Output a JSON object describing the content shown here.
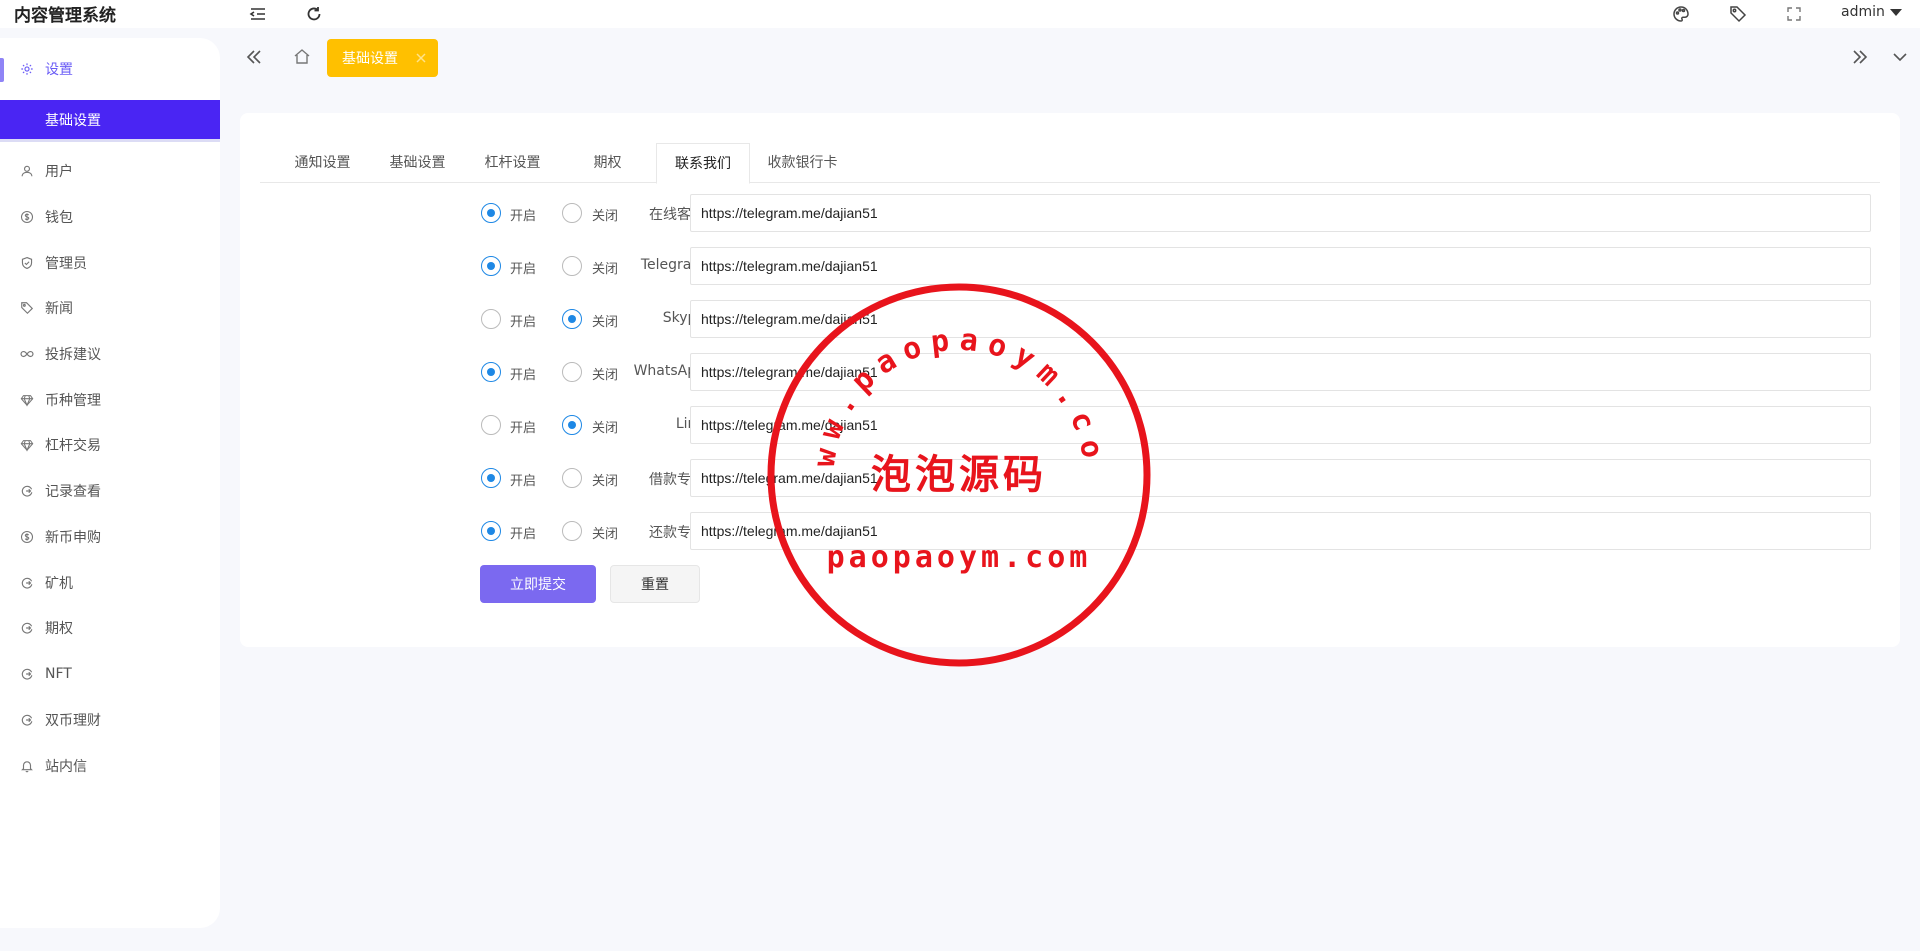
{
  "app": {
    "title": "内容管理系统",
    "user": "admin"
  },
  "header_icons": [
    "menu-fold-icon",
    "refresh-icon",
    "palette-icon",
    "tag-icon",
    "fullscreen-icon"
  ],
  "sidebar": {
    "parent": {
      "label": "设置",
      "icon": "gear-icon"
    },
    "active_sub": "基础设置",
    "items": [
      {
        "label": "用户",
        "icon": "user-icon"
      },
      {
        "label": "钱包",
        "icon": "dollar-icon"
      },
      {
        "label": "管理员",
        "icon": "shield-icon"
      },
      {
        "label": "新闻",
        "icon": "tag-icon"
      },
      {
        "label": "投拆建议",
        "icon": "infinity-icon"
      },
      {
        "label": "币种管理",
        "icon": "diamond-icon"
      },
      {
        "label": "杠杆交易",
        "icon": "diamond-icon"
      },
      {
        "label": "记录查看",
        "icon": "circle-arrow-icon"
      },
      {
        "label": "新币申购",
        "icon": "dollar-icon"
      },
      {
        "label": "矿机",
        "icon": "circle-arrow-icon"
      },
      {
        "label": "期权",
        "icon": "circle-arrow-icon"
      },
      {
        "label": "NFT",
        "icon": "circle-arrow-icon"
      },
      {
        "label": "双币理财",
        "icon": "circle-arrow-icon"
      },
      {
        "label": "站内信",
        "icon": "bell-icon"
      }
    ]
  },
  "tabbar": {
    "active_page": "基础设置"
  },
  "settings_tabs": [
    "通知设置",
    "基础设置",
    "杠杆设置",
    "期权",
    "联系我们",
    "收款银行卡"
  ],
  "active_tab_index": 4,
  "radio_labels": {
    "on": "开启",
    "off": "关闭"
  },
  "contacts": [
    {
      "label": "在线客服",
      "enabled": true,
      "url": "https://telegram.me/dajian51"
    },
    {
      "label": "Telegram",
      "enabled": true,
      "url": "https://telegram.me/dajian51"
    },
    {
      "label": "Skype",
      "enabled": false,
      "url": "https://telegram.me/dajian51"
    },
    {
      "label": "WhatsApp",
      "enabled": true,
      "url": "https://telegram.me/dajian51"
    },
    {
      "label": "Line",
      "enabled": false,
      "url": "https://telegram.me/dajian51"
    },
    {
      "label": "借款专员",
      "enabled": true,
      "url": "https://telegram.me/dajian51"
    },
    {
      "label": "还款专员",
      "enabled": true,
      "url": "https://telegram.me/dajian51"
    }
  ],
  "buttons": {
    "submit": "立即提交",
    "reset": "重置"
  },
  "watermark": {
    "arc_text": "www.paopaoym.com",
    "center_text": "泡泡源码",
    "bottom_text": "paopaoym.com",
    "color": "#e8141c"
  },
  "colors": {
    "accent": "#4a25f3",
    "tab_yellow": "#ffc000",
    "radio_blue": "#1e88e5",
    "submit": "#7b69f0"
  }
}
